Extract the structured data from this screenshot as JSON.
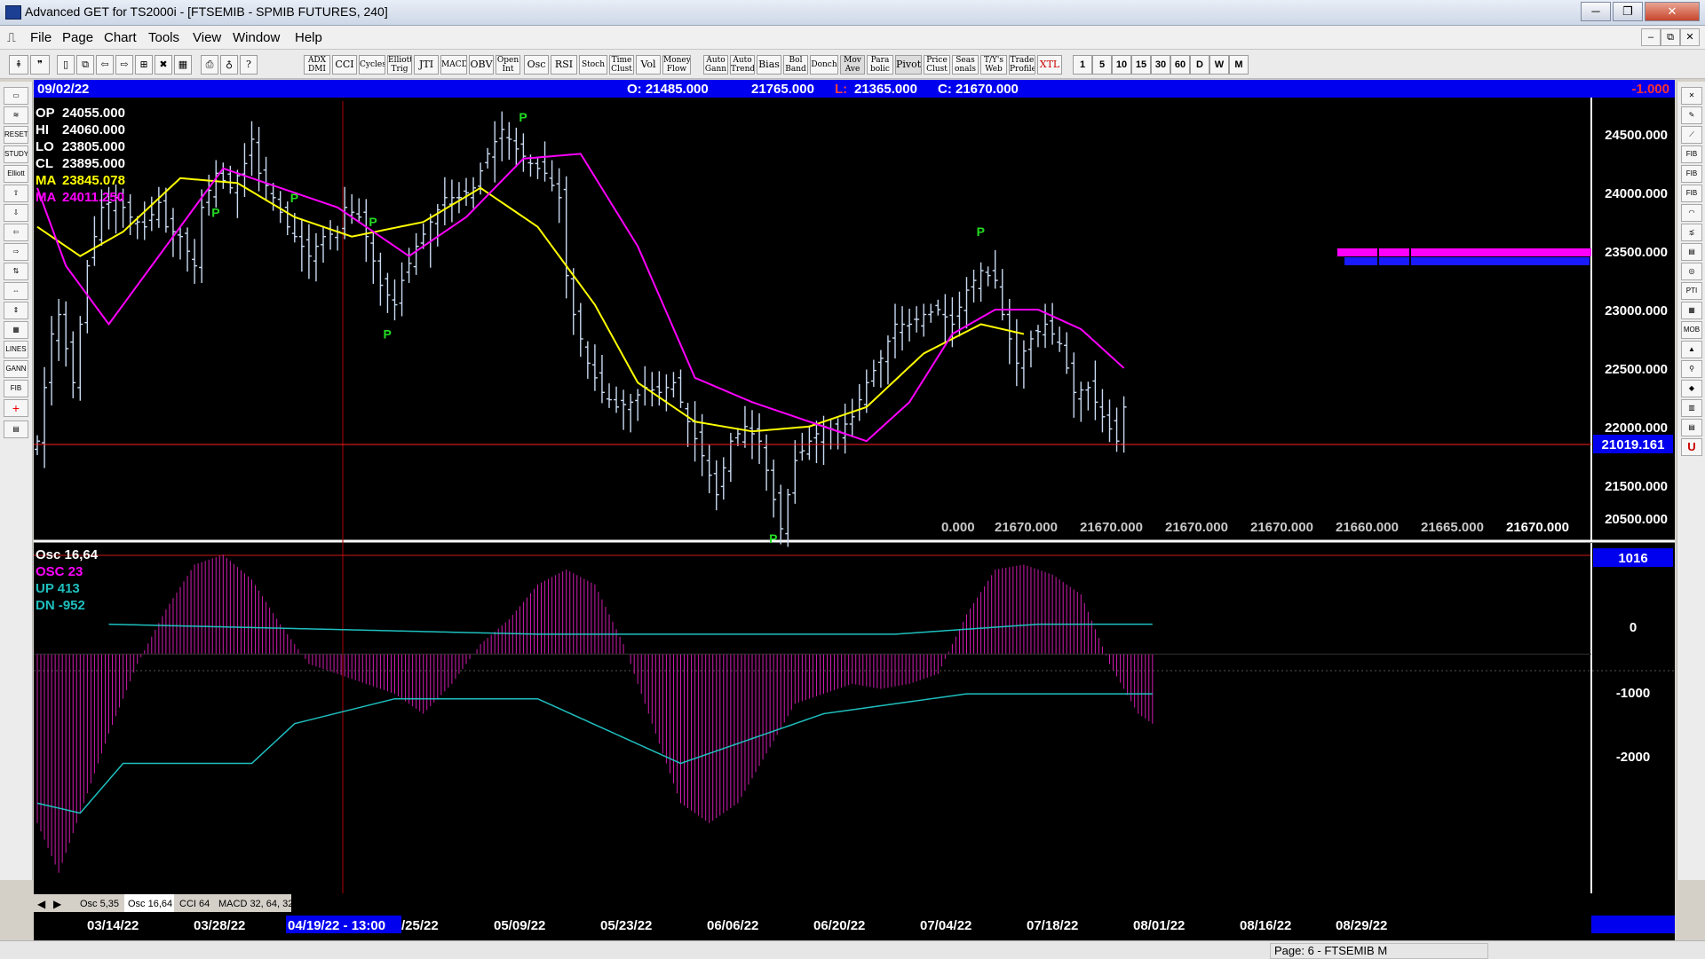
{
  "window": {
    "title": "Advanced GET for TS2000i - [FTSEMIB - SPMIB FUTURES, 240]",
    "minimize": "─",
    "restore": "❐",
    "close": "✕"
  },
  "menu": {
    "items": [
      "File",
      "Page",
      "Chart",
      "Tools",
      "View",
      "Window",
      "Help"
    ],
    "mdi_minimize": "–",
    "mdi_restore": "⧉",
    "mdi_close": "✕"
  },
  "toolbar": {
    "indicators": [
      "ADX DMI",
      "CCI",
      "Cycles",
      "Elliott Trig",
      "JTI",
      "MACD",
      "OBV",
      "Open Int",
      "Osc",
      "RSI",
      "Stoch",
      "Time Clust",
      "Vol",
      "Money Flow",
      "Auto Gann",
      "Auto Trend",
      "Bias",
      "Bol Band",
      "Donch",
      "Mov Ave",
      "Para bolic",
      "Pivot",
      "Price Clust",
      "Seas onals",
      "T/Y's Web",
      "Trade Profile",
      "XTL"
    ],
    "periods": [
      "1",
      "5",
      "10",
      "15",
      "30",
      "60",
      "D",
      "W",
      "M"
    ]
  },
  "header": {
    "date": "09/02/22",
    "open": "O: 21485.000",
    "high": "21765.000",
    "low_label": "L:",
    "low": "21365.000",
    "close": "C: 21670.000",
    "change": "-1.000"
  },
  "legend": {
    "lines": [
      {
        "label": "OP",
        "value": "24055.000",
        "color": "#ffffff"
      },
      {
        "label": "HI",
        "value": "24060.000",
        "color": "#ffffff"
      },
      {
        "label": "LO",
        "value": "23805.000",
        "color": "#ffffff"
      },
      {
        "label": "CL",
        "value": "23895.000",
        "color": "#ffffff"
      },
      {
        "label": "MA",
        "value": "23845.078",
        "color": "#ffff00"
      },
      {
        "label": "MA",
        "value": "24011.250",
        "color": "#ff00ff"
      }
    ]
  },
  "price_axis": {
    "ticks": [
      "24500.000",
      "24000.000",
      "23500.000",
      "23000.000",
      "22500.000",
      "22000.000",
      "21500.000",
      "20500.000"
    ],
    "current_line": "21019.161"
  },
  "bottom_values": [
    "0.000",
    "21670.000",
    "21670.000",
    "21670.000",
    "21670.000",
    "21660.000",
    "21665.000",
    "21670.000"
  ],
  "pivot_marker": "P",
  "osc_panel": {
    "title": "Osc 16,64",
    "lines": [
      {
        "label": "OSC 23",
        "color": "#ff00ff"
      },
      {
        "label": "UP  413",
        "color": "#1fbfbf"
      },
      {
        "label": "DN  -952",
        "color": "#1fbfbf"
      }
    ],
    "axis": [
      "1016",
      "0",
      "-1000",
      "-2000"
    ]
  },
  "tabs": [
    "Osc 5,35",
    "Osc 16,64",
    "CCI 64",
    "MACD 32, 64, 32"
  ],
  "date_axis": {
    "labels": [
      "03/14/22",
      "03/28/22",
      "04/19/22 - 13:00",
      "/25/22",
      "05/09/22",
      "05/23/22",
      "06/06/22",
      "06/20/22",
      "07/04/22",
      "07/18/22",
      "08/01/22",
      "08/16/22",
      "08/29/22"
    ]
  },
  "status": {
    "page": "Page: 6 - FTSEMIB M"
  },
  "colors": {
    "accent": "#0000ff",
    "ma_fast": "#ffff00",
    "ma_slow": "#ff00ff",
    "bars": "#c8daf2",
    "osc": "#d01cb0",
    "pivot": "#22dd22",
    "current": "#ff2020"
  },
  "chart_data": [
    {
      "type": "candlestick",
      "title": "FTSEMIB - SPMIB FUTURES, 240",
      "ylim": [
        20300,
        24800
      ],
      "x": [
        "03/14/22",
        "03/28/22",
        "04/19/22",
        "05/09/22",
        "05/23/22",
        "06/06/22",
        "06/20/22",
        "07/04/22",
        "07/18/22",
        "08/01/22",
        "08/16/22",
        "08/29/22",
        "09/02/22"
      ],
      "close_path": [
        [
          0,
          21300
        ],
        [
          2,
          22400
        ],
        [
          3,
          22600
        ],
        [
          5,
          21900
        ],
        [
          7,
          23100
        ],
        [
          9,
          23700
        ],
        [
          11,
          23800
        ],
        [
          13,
          23600
        ],
        [
          15,
          23500
        ],
        [
          17,
          23750
        ],
        [
          18,
          23500
        ],
        [
          20,
          23400
        ],
        [
          22,
          23100
        ],
        [
          23,
          23700
        ],
        [
          25,
          24050
        ],
        [
          27,
          23900
        ],
        [
          29,
          24150
        ],
        [
          30,
          24400
        ],
        [
          31,
          24050
        ],
        [
          33,
          23800
        ],
        [
          35,
          23500
        ],
        [
          37,
          23300
        ],
        [
          38,
          23200
        ],
        [
          40,
          23400
        ],
        [
          42,
          23450
        ],
        [
          43,
          23700
        ],
        [
          45,
          23600
        ],
        [
          46,
          23400
        ],
        [
          48,
          22900
        ],
        [
          50,
          22700
        ],
        [
          51,
          22950
        ],
        [
          53,
          23300
        ],
        [
          55,
          23550
        ],
        [
          57,
          23800
        ],
        [
          59,
          23800
        ],
        [
          61,
          23900
        ],
        [
          63,
          24250
        ],
        [
          65,
          24500
        ],
        [
          67,
          24300
        ],
        [
          69,
          24150
        ],
        [
          71,
          24050
        ],
        [
          73,
          23800
        ],
        [
          74,
          23000
        ],
        [
          75,
          22600
        ],
        [
          77,
          22100
        ],
        [
          79,
          21800
        ],
        [
          81,
          21650
        ],
        [
          83,
          21700
        ],
        [
          85,
          21850
        ],
        [
          87,
          21800
        ],
        [
          89,
          21900
        ],
        [
          91,
          21500
        ],
        [
          93,
          21150
        ],
        [
          95,
          20750
        ],
        [
          97,
          21300
        ],
        [
          99,
          21450
        ],
        [
          101,
          21300
        ],
        [
          103,
          20700
        ],
        [
          104,
          20400
        ],
        [
          106,
          21100
        ],
        [
          108,
          21300
        ],
        [
          110,
          21450
        ],
        [
          112,
          21400
        ],
        [
          114,
          21550
        ],
        [
          116,
          21900
        ],
        [
          118,
          22150
        ],
        [
          120,
          22500
        ],
        [
          122,
          22500
        ],
        [
          124,
          22600
        ],
        [
          126,
          22650
        ],
        [
          128,
          22500
        ],
        [
          130,
          22850
        ],
        [
          132,
          23050
        ],
        [
          134,
          22950
        ],
        [
          135,
          22600
        ],
        [
          137,
          22100
        ],
        [
          139,
          22350
        ],
        [
          141,
          22500
        ],
        [
          143,
          22300
        ],
        [
          145,
          21800
        ],
        [
          147,
          21850
        ],
        [
          149,
          21550
        ],
        [
          151,
          21300
        ],
        [
          152,
          21650
        ]
      ],
      "ma_fast": [
        [
          0,
          23500
        ],
        [
          6,
          23200
        ],
        [
          12,
          23450
        ],
        [
          20,
          24000
        ],
        [
          28,
          23950
        ],
        [
          36,
          23600
        ],
        [
          44,
          23400
        ],
        [
          54,
          23550
        ],
        [
          62,
          23900
        ],
        [
          70,
          23500
        ],
        [
          78,
          22700
        ],
        [
          84,
          21900
        ],
        [
          92,
          21500
        ],
        [
          100,
          21400
        ],
        [
          108,
          21450
        ],
        [
          116,
          21650
        ],
        [
          124,
          22200
        ],
        [
          132,
          22500
        ],
        [
          138,
          22400
        ]
      ],
      "ma_slow": [
        [
          0,
          23900
        ],
        [
          4,
          23100
        ],
        [
          10,
          22500
        ],
        [
          18,
          23300
        ],
        [
          26,
          24100
        ],
        [
          34,
          23900
        ],
        [
          42,
          23700
        ],
        [
          52,
          23200
        ],
        [
          60,
          23600
        ],
        [
          68,
          24200
        ],
        [
          76,
          24250
        ],
        [
          84,
          23300
        ],
        [
          92,
          21950
        ],
        [
          100,
          21700
        ],
        [
          108,
          21500
        ],
        [
          116,
          21300
        ],
        [
          122,
          21700
        ],
        [
          128,
          22400
        ],
        [
          134,
          22650
        ],
        [
          140,
          22650
        ],
        [
          146,
          22450
        ],
        [
          152,
          22050
        ]
      ],
      "pivots": [
        {
          "i": 25,
          "type": "low"
        },
        {
          "i": 36,
          "type": "high"
        },
        {
          "i": 47,
          "type": "high"
        },
        {
          "i": 49,
          "type": "low"
        },
        {
          "i": 68,
          "type": "high"
        },
        {
          "i": 103,
          "type": "low"
        },
        {
          "i": 132,
          "type": "high"
        }
      ],
      "ylabel": ""
    },
    {
      "type": "bar",
      "title": "Osc 16,64",
      "ylim": [
        -2300,
        1100
      ],
      "osc_path": [
        [
          0,
          -1700
        ],
        [
          3,
          -2200
        ],
        [
          6,
          -1600
        ],
        [
          10,
          -800
        ],
        [
          14,
          -100
        ],
        [
          18,
          450
        ],
        [
          22,
          900
        ],
        [
          26,
          1000
        ],
        [
          30,
          750
        ],
        [
          34,
          300
        ],
        [
          38,
          -100
        ],
        [
          42,
          -200
        ],
        [
          46,
          -300
        ],
        [
          50,
          -400
        ],
        [
          54,
          -600
        ],
        [
          58,
          -300
        ],
        [
          62,
          100
        ],
        [
          66,
          350
        ],
        [
          70,
          700
        ],
        [
          74,
          850
        ],
        [
          78,
          700
        ],
        [
          82,
          100
        ],
        [
          86,
          -700
        ],
        [
          90,
          -1500
        ],
        [
          94,
          -1700
        ],
        [
          98,
          -1500
        ],
        [
          102,
          -1000
        ],
        [
          106,
          -500
        ],
        [
          110,
          -400
        ],
        [
          114,
          -300
        ],
        [
          118,
          -350
        ],
        [
          122,
          -300
        ],
        [
          126,
          -200
        ],
        [
          130,
          400
        ],
        [
          134,
          850
        ],
        [
          138,
          900
        ],
        [
          142,
          800
        ],
        [
          146,
          600
        ],
        [
          150,
          -100
        ],
        [
          154,
          -600
        ],
        [
          156,
          -700
        ]
      ],
      "up_path": [
        [
          10,
          300
        ],
        [
          40,
          250
        ],
        [
          70,
          200
        ],
        [
          100,
          200
        ],
        [
          120,
          200
        ],
        [
          140,
          300
        ],
        [
          156,
          300
        ]
      ],
      "dn_path": [
        [
          0,
          -1500
        ],
        [
          6,
          -1600
        ],
        [
          12,
          -1100
        ],
        [
          30,
          -1100
        ],
        [
          36,
          -700
        ],
        [
          50,
          -450
        ],
        [
          70,
          -450
        ],
        [
          90,
          -1100
        ],
        [
          110,
          -600
        ],
        [
          130,
          -400
        ],
        [
          156,
          -400
        ]
      ]
    }
  ]
}
